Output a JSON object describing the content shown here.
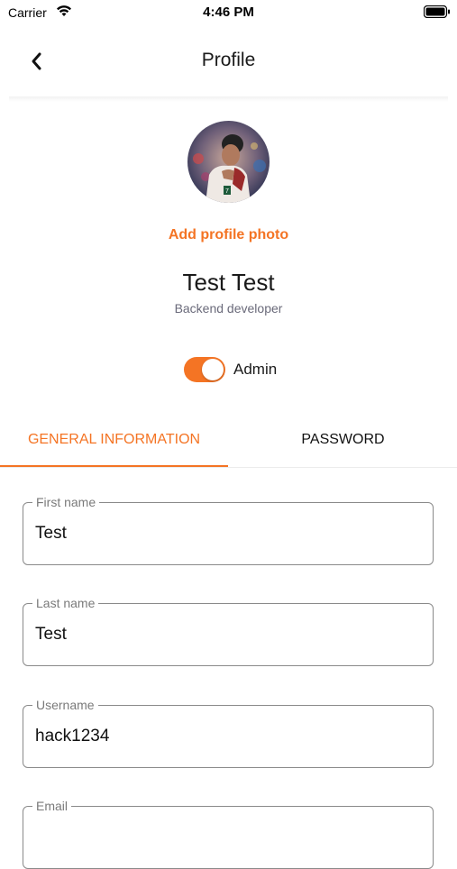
{
  "status_bar": {
    "carrier": "Carrier",
    "time": "4:46 PM"
  },
  "nav": {
    "title": "Profile",
    "back_icon": "chevron-left-icon"
  },
  "profile": {
    "add_photo": "Add profile photo",
    "name": "Test Test",
    "role": "Backend developer",
    "admin_label": "Admin",
    "admin_enabled": true
  },
  "tabs": [
    {
      "label": "GENERAL INFORMATION",
      "active": true
    },
    {
      "label": "PASSWORD",
      "active": false
    }
  ],
  "fields": {
    "first_name": {
      "label": "First name",
      "value": "Test"
    },
    "last_name": {
      "label": "Last name",
      "value": "Test"
    },
    "username": {
      "label": "Username",
      "value": "hack1234"
    },
    "email": {
      "label": "Email",
      "value": ""
    }
  },
  "colors": {
    "accent": "#f47424",
    "text": "#111111",
    "muted": "#7a7a7a"
  }
}
